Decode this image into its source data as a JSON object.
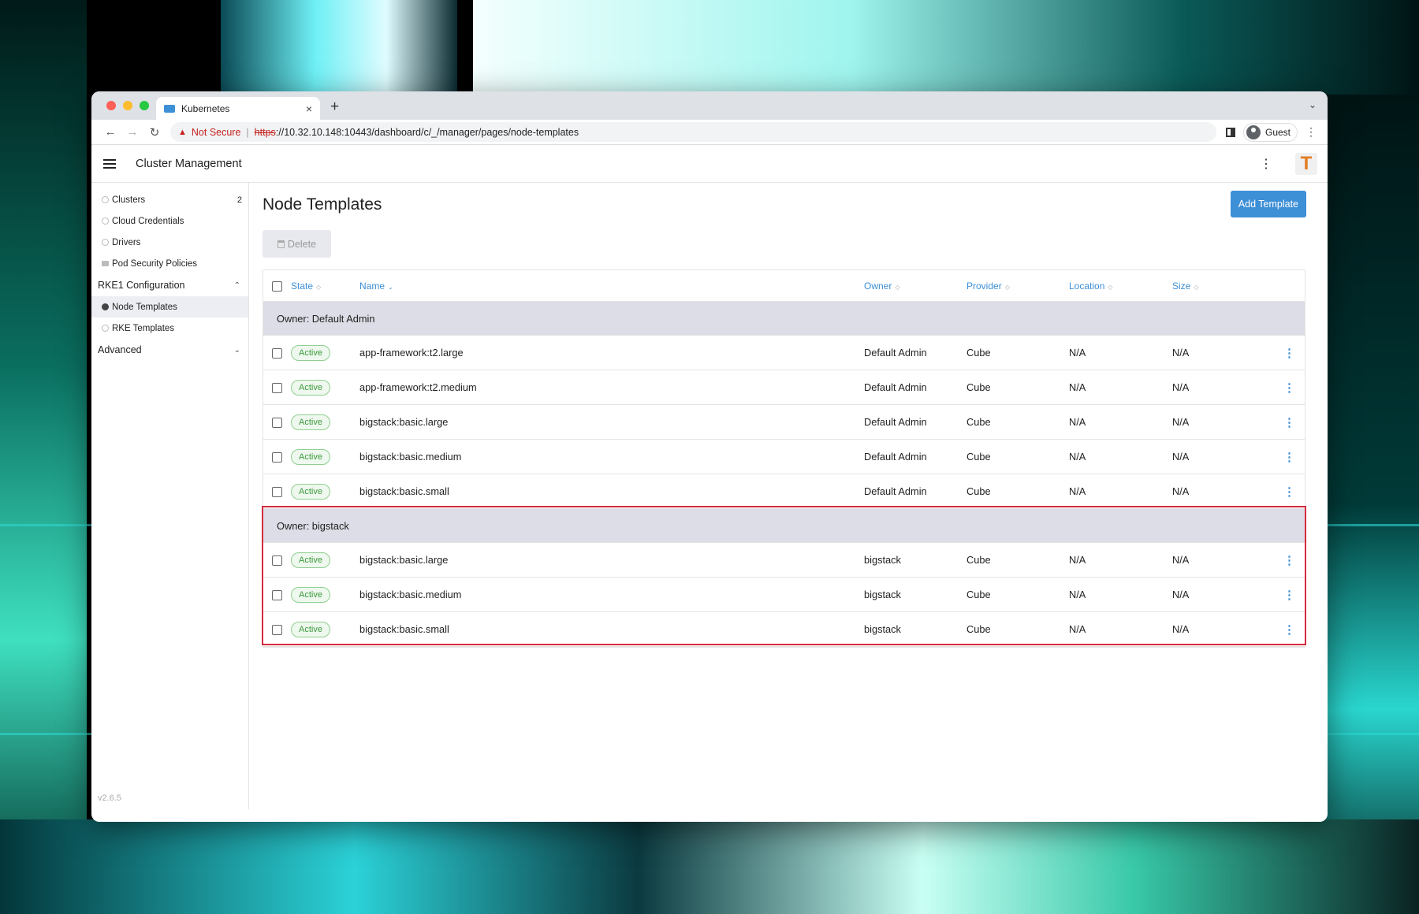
{
  "browser": {
    "tab_title": "Kubernetes",
    "new_tab": "+",
    "security_label": "Not Secure",
    "url_scheme": "https",
    "url_rest": "://10.32.10.148:10443/dashboard/c/_/manager/pages/node-templates",
    "profile": "Guest"
  },
  "app": {
    "title": "Cluster Management",
    "logo_letter": "T",
    "version": "v2.6.5"
  },
  "sidebar": {
    "items": [
      {
        "label": "Clusters",
        "count": "2"
      },
      {
        "label": "Cloud Credentials"
      },
      {
        "label": "Drivers"
      },
      {
        "label": "Pod Security Policies"
      }
    ],
    "group_rke1": "RKE1 Configuration",
    "rke1_items": [
      {
        "label": "Node Templates"
      },
      {
        "label": "RKE Templates"
      }
    ],
    "group_advanced": "Advanced"
  },
  "page": {
    "title": "Node Templates",
    "add_button": "Add Template",
    "delete_button": "Delete"
  },
  "table": {
    "columns": [
      "State",
      "Name",
      "Owner",
      "Provider",
      "Location",
      "Size"
    ],
    "groups": [
      {
        "label": "Owner: Default Admin",
        "rows": [
          {
            "state": "Active",
            "name": "app-framework:t2.large",
            "owner": "Default Admin",
            "provider": "Cube",
            "location": "N/A",
            "size": "N/A"
          },
          {
            "state": "Active",
            "name": "app-framework:t2.medium",
            "owner": "Default Admin",
            "provider": "Cube",
            "location": "N/A",
            "size": "N/A"
          },
          {
            "state": "Active",
            "name": "bigstack:basic.large",
            "owner": "Default Admin",
            "provider": "Cube",
            "location": "N/A",
            "size": "N/A"
          },
          {
            "state": "Active",
            "name": "bigstack:basic.medium",
            "owner": "Default Admin",
            "provider": "Cube",
            "location": "N/A",
            "size": "N/A"
          },
          {
            "state": "Active",
            "name": "bigstack:basic.small",
            "owner": "Default Admin",
            "provider": "Cube",
            "location": "N/A",
            "size": "N/A"
          }
        ]
      },
      {
        "label": "Owner: bigstack",
        "rows": [
          {
            "state": "Active",
            "name": "bigstack:basic.large",
            "owner": "bigstack",
            "provider": "Cube",
            "location": "N/A",
            "size": "N/A"
          },
          {
            "state": "Active",
            "name": "bigstack:basic.medium",
            "owner": "bigstack",
            "provider": "Cube",
            "location": "N/A",
            "size": "N/A"
          },
          {
            "state": "Active",
            "name": "bigstack:basic.small",
            "owner": "bigstack",
            "provider": "Cube",
            "location": "N/A",
            "size": "N/A"
          }
        ]
      }
    ]
  },
  "colors": {
    "accent": "#3d8fd6",
    "highlight": "#d62b3f",
    "active_badge": "#3c9a3c"
  }
}
